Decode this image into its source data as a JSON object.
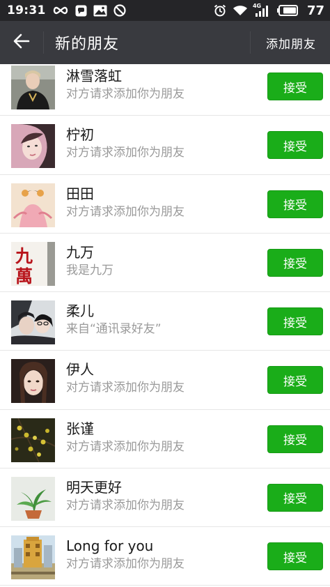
{
  "status_bar": {
    "time": "19:31",
    "battery_level": "77",
    "network_label": "4G",
    "icons": [
      "infinity-icon",
      "message-icon",
      "image-icon",
      "block-icon",
      "alarm-icon",
      "wifi-icon",
      "signal-icon",
      "battery-icon"
    ]
  },
  "app_bar": {
    "title": "新的朋友",
    "action_label": "添加朋友",
    "back_icon": "back-arrow-icon",
    "background": "#393a3f"
  },
  "accept_color": "#1aad19",
  "friends": [
    {
      "name": "淋雪落虹",
      "message": "对方请求添加你为朋友",
      "accept_label": "接受",
      "avatar": "avatar-photo-1"
    },
    {
      "name": "柠初",
      "message": "对方请求添加你为朋友",
      "accept_label": "接受",
      "avatar": "avatar-photo-2"
    },
    {
      "name": "田田",
      "message": "对方请求添加你为朋友",
      "accept_label": "接受",
      "avatar": "avatar-illustration"
    },
    {
      "name": "九万",
      "message": "我是九万",
      "accept_label": "接受",
      "avatar": "avatar-calligraphy",
      "avatar_text": "九萬"
    },
    {
      "name": "柔儿",
      "message": "来自“通讯录好友”",
      "accept_label": "接受",
      "avatar": "avatar-photo-3"
    },
    {
      "name": "伊人",
      "message": "对方请求添加你为朋友",
      "accept_label": "接受",
      "avatar": "avatar-photo-4"
    },
    {
      "name": "张谨",
      "message": "对方请求添加你为朋友",
      "accept_label": "接受",
      "avatar": "avatar-berries"
    },
    {
      "name": "明天更好",
      "message": "对方请求添加你为朋友",
      "accept_label": "接受",
      "avatar": "avatar-plant"
    },
    {
      "name": "Long for you",
      "message": "对方请求添加你为朋友",
      "accept_label": "接受",
      "avatar": "avatar-building"
    }
  ]
}
